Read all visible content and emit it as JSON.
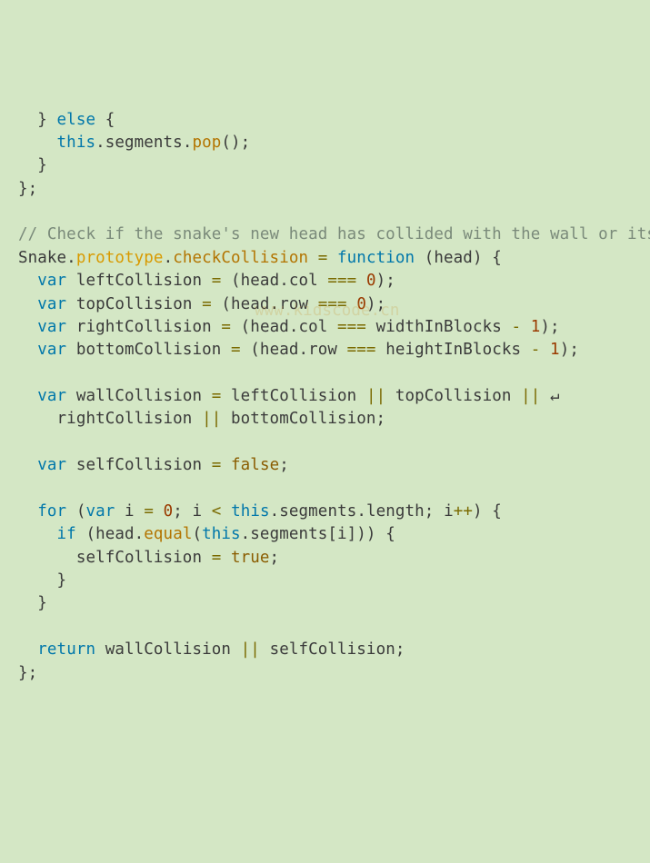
{
  "code": {
    "l01_a": "  } ",
    "l01_else": "else",
    "l01_b": " {",
    "l02_a": "    ",
    "l02_this": "this",
    "l02_b": ".segments.",
    "l02_pop": "pop",
    "l02_c": "();",
    "l03": "  }",
    "l04": "};",
    "l05": "",
    "l06_cmt": "// Check if the snake's new head has collided with the wall or itself",
    "l07_a": "Snake.",
    "l07_proto": "prototype",
    "l07_b": ".",
    "l07_check": "checkCollision",
    "l07_c": " ",
    "l07_eq": "=",
    "l07_d": " ",
    "l07_fn": "function",
    "l07_e": " (head) {",
    "l08_a": "  ",
    "l08_var": "var",
    "l08_b": " leftCollision ",
    "l08_eq": "=",
    "l08_c": " (head.col ",
    "l08_teq": "===",
    "l08_d": " ",
    "l08_num": "0",
    "l08_e": ");",
    "l09_a": "  ",
    "l09_var": "var",
    "l09_b": " topCollision ",
    "l09_eq": "=",
    "l09_c": " (head.row ",
    "l09_teq": "===",
    "l09_d": " ",
    "l09_num": "0",
    "l09_e": ");",
    "l10_a": "  ",
    "l10_var": "var",
    "l10_b": " rightCollision ",
    "l10_eq": "=",
    "l10_c": " (head.col ",
    "l10_teq": "===",
    "l10_d": " widthInBlocks ",
    "l10_minus": "-",
    "l10_e": " ",
    "l10_num": "1",
    "l10_f": ");",
    "l11_a": "  ",
    "l11_var": "var",
    "l11_b": " bottomCollision ",
    "l11_eq": "=",
    "l11_c": " (head.row ",
    "l11_teq": "===",
    "l11_d": " heightInBlocks ",
    "l11_minus": "-",
    "l11_e": " ",
    "l11_num": "1",
    "l11_f": ");",
    "l12": "",
    "l13_a": "  ",
    "l13_var": "var",
    "l13_b": " wallCollision ",
    "l13_eq": "=",
    "l13_c": " leftCollision ",
    "l13_or1": "||",
    "l13_d": " topCollision ",
    "l13_or2": "||",
    "l13_e": " ",
    "l13_cont": "↵",
    "l14_a": "    rightCollision ",
    "l14_or": "||",
    "l14_b": " bottomCollision;",
    "l15": "",
    "l16_a": "  ",
    "l16_var": "var",
    "l16_b": " selfCollision ",
    "l16_eq": "=",
    "l16_c": " ",
    "l16_false": "false",
    "l16_d": ";",
    "l17": "",
    "l18_a": "  ",
    "l18_for": "for",
    "l18_b": " (",
    "l18_var": "var",
    "l18_c": " i ",
    "l18_eq": "=",
    "l18_d": " ",
    "l18_num": "0",
    "l18_e": "; i ",
    "l18_lt": "<",
    "l18_f": " ",
    "l18_this": "this",
    "l18_g": ".segments.length; i",
    "l18_pp": "++",
    "l18_h": ") {",
    "l19_a": "    ",
    "l19_if": "if",
    "l19_b": " (head.",
    "l19_equal": "equal",
    "l19_c": "(",
    "l19_this": "this",
    "l19_d": ".segments[i])) {",
    "l20_a": "      selfCollision ",
    "l20_eq": "=",
    "l20_b": " ",
    "l20_true": "true",
    "l20_c": ";",
    "l21": "    }",
    "l22": "  }",
    "l23": "",
    "l24_a": "  ",
    "l24_ret": "return",
    "l24_b": " wallCollision ",
    "l24_or": "||",
    "l24_c": " selfCollision;",
    "l25": "};"
  },
  "watermark": "www.kidscode.cn"
}
